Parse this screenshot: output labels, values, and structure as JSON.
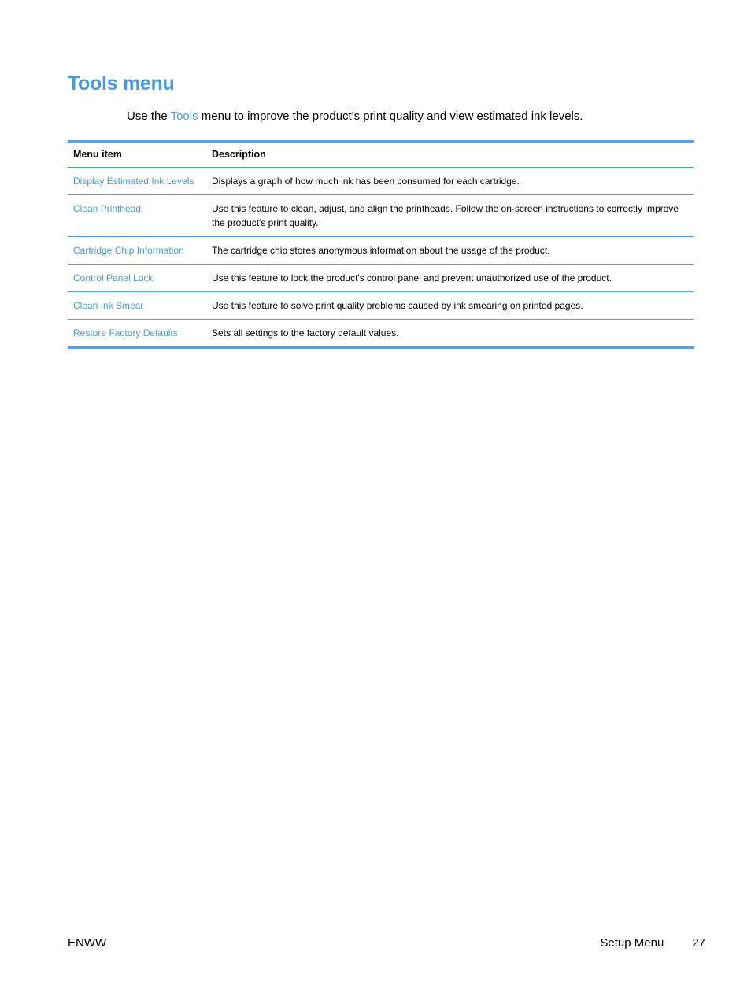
{
  "heading": "Tools menu",
  "intro": {
    "before": "Use the ",
    "link": "Tools",
    "after": " menu to improve the product's print quality and view estimated ink levels."
  },
  "table": {
    "headers": [
      "Menu item",
      "Description"
    ],
    "rows": [
      {
        "item": "Display Estimated Ink Levels",
        "description": "Displays a graph of how much ink has been consumed for each cartridge."
      },
      {
        "item": "Clean Printhead",
        "description": "Use this feature to clean, adjust, and align the printheads. Follow the on-screen instructions to correctly improve the product's print quality."
      },
      {
        "item": "Cartridge Chip Information",
        "description": "The cartridge chip stores anonymous information about the usage of the product."
      },
      {
        "item": "Control Panel Lock",
        "description": "Use this feature to lock the product's control panel and prevent unauthorized use of the product."
      },
      {
        "item": "Clean Ink Smear",
        "description": "Use this feature to solve print quality problems caused by ink smearing on printed pages."
      },
      {
        "item": "Restore Factory Defaults",
        "description": "Sets all settings to the factory default values."
      }
    ]
  },
  "footer": {
    "left": "ENWW",
    "section": "Setup Menu",
    "page": "27"
  },
  "colors": {
    "accent": "#4b9ad4",
    "rule": "#5b9fd6"
  }
}
